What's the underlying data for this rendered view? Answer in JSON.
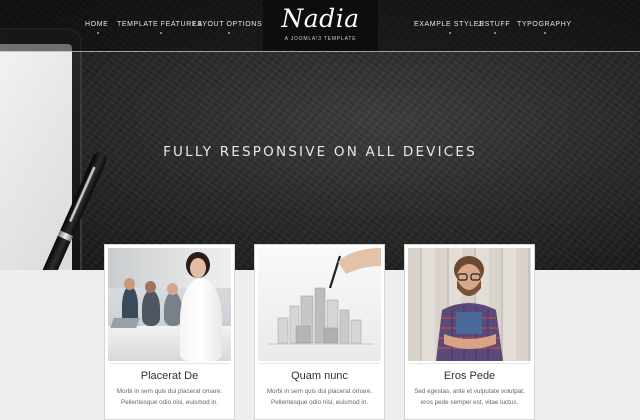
{
  "nav": {
    "left": [
      "HOME",
      "TEMPLATE FEATURES",
      "LAYOUT OPTIONS"
    ],
    "right": [
      "EXAMPLE STYLES",
      "J!STUFF",
      "TYPOGRAPHY"
    ]
  },
  "logo": {
    "name": "Nadia",
    "tagline": "A JOOMLA!3 TEMPLATE"
  },
  "hero": {
    "title": "FULLY RESPONSIVE ON ALL DEVICES"
  },
  "cards": [
    {
      "title": "Placerat De",
      "line1": "Morbi in sem quis dui placerat ornare.",
      "line2": "Pellentesque odio nisi, euismod in."
    },
    {
      "title": "Quam nunc",
      "line1": "Morbi in sem quis dui placerat ornare.",
      "line2": "Pellentesque odio nisi, euismod in."
    },
    {
      "title": "Eros Pede",
      "line1": "Sed egestas, ante et vulputate volutpat,",
      "line2": "eros pede semper est, vitae luctus."
    }
  ]
}
